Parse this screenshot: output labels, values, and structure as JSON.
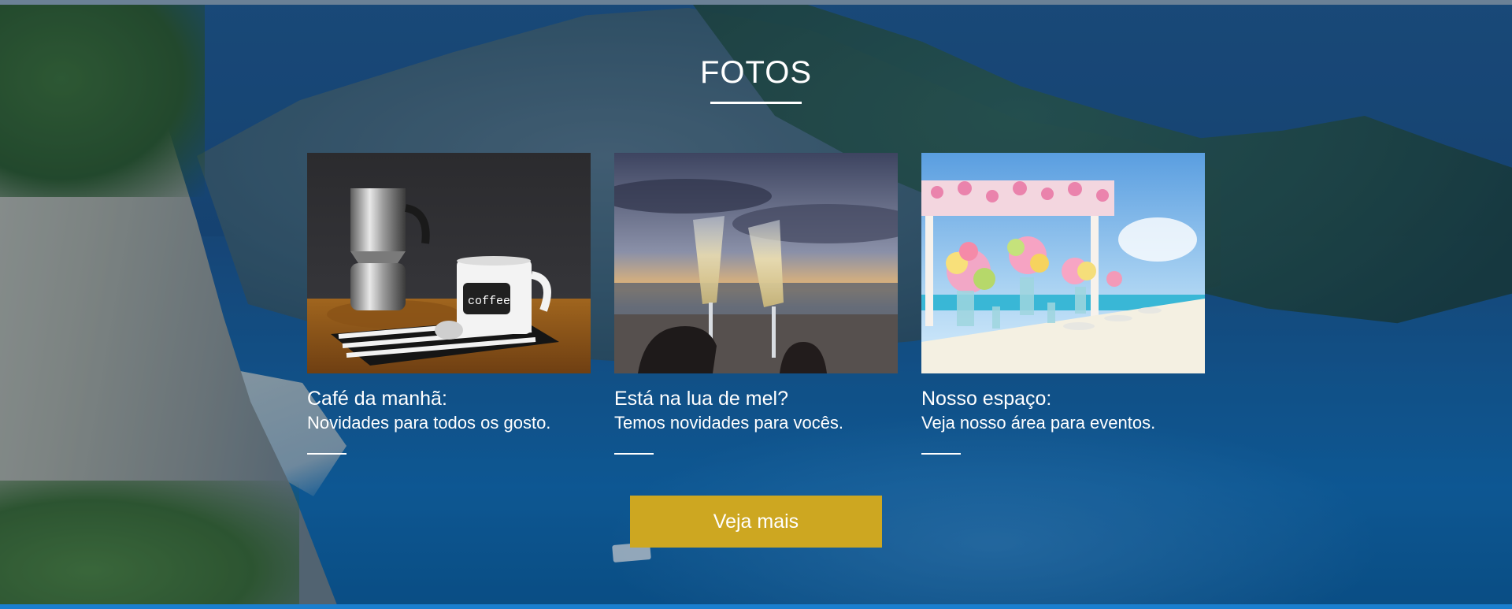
{
  "section": {
    "title": "FOTOS",
    "cta_label": "Veja mais"
  },
  "cards": [
    {
      "heading": "Café da manhã:",
      "subtitle": "Novidades para todos os gosto.",
      "photo_text": "coffee"
    },
    {
      "heading": "Está na lua de mel?",
      "subtitle": "Temos novidades para vocês."
    },
    {
      "heading": "Nosso espaço:",
      "subtitle": "Veja nosso área para eventos."
    }
  ],
  "colors": {
    "cta_background": "#cda721",
    "text": "#ffffff",
    "overlay": "#0d3f6e"
  }
}
